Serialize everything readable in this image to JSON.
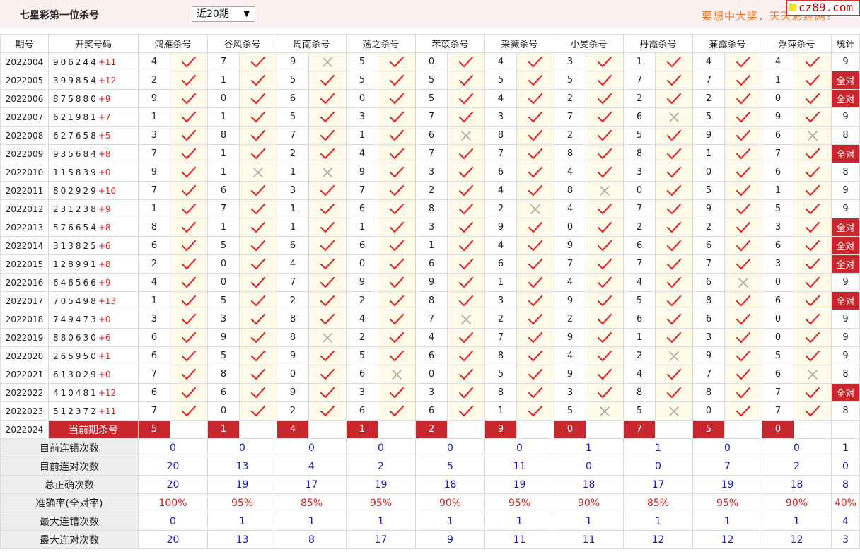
{
  "header": {
    "title": "七星彩第一位杀号",
    "period_select": "近20期",
    "slogan": "要想中大奖，天天彩经网！",
    "site": "cz89.com"
  },
  "columns": {
    "period": "期号",
    "numbers": "开奖号码",
    "experts": [
      "鸿雁杀号",
      "谷风杀号",
      "周南杀号",
      "荡之杀号",
      "芣苡杀号",
      "采薇杀号",
      "小旻杀号",
      "丹霞杀号",
      "蒹露杀号",
      "浮萍杀号"
    ],
    "stat": "统计"
  },
  "rows": [
    {
      "period": "2022004",
      "nums": "906244",
      "extra": "+11",
      "kills": [
        4,
        7,
        9,
        5,
        0,
        4,
        3,
        1,
        4,
        4
      ],
      "ok": [
        1,
        1,
        0,
        1,
        1,
        1,
        1,
        1,
        1,
        1
      ],
      "stat": "9"
    },
    {
      "period": "2022005",
      "nums": "399854",
      "extra": "+12",
      "kills": [
        2,
        1,
        5,
        5,
        5,
        5,
        5,
        7,
        7,
        1
      ],
      "ok": [
        1,
        1,
        1,
        1,
        1,
        1,
        1,
        1,
        1,
        1
      ],
      "stat": "全对"
    },
    {
      "period": "2022006",
      "nums": "875880",
      "extra": "+9",
      "kills": [
        9,
        0,
        6,
        0,
        5,
        4,
        2,
        2,
        2,
        0
      ],
      "ok": [
        1,
        1,
        1,
        1,
        1,
        1,
        1,
        1,
        1,
        1
      ],
      "stat": "全对"
    },
    {
      "period": "2022007",
      "nums": "621981",
      "extra": "+7",
      "kills": [
        1,
        1,
        5,
        3,
        7,
        3,
        7,
        6,
        5,
        9
      ],
      "ok": [
        1,
        1,
        1,
        1,
        1,
        1,
        1,
        0,
        1,
        1
      ],
      "stat": "9"
    },
    {
      "period": "2022008",
      "nums": "627658",
      "extra": "+5",
      "kills": [
        3,
        8,
        7,
        1,
        6,
        8,
        2,
        5,
        9,
        6
      ],
      "ok": [
        1,
        1,
        1,
        1,
        0,
        1,
        1,
        1,
        1,
        0
      ],
      "stat": "8"
    },
    {
      "period": "2022009",
      "nums": "935684",
      "extra": "+8",
      "kills": [
        7,
        1,
        2,
        4,
        7,
        7,
        8,
        8,
        1,
        7
      ],
      "ok": [
        1,
        1,
        1,
        1,
        1,
        1,
        1,
        1,
        1,
        1
      ],
      "stat": "全对"
    },
    {
      "period": "2022010",
      "nums": "115839",
      "extra": "+0",
      "kills": [
        9,
        1,
        1,
        9,
        3,
        6,
        4,
        3,
        0,
        6
      ],
      "ok": [
        1,
        0,
        0,
        1,
        1,
        1,
        1,
        1,
        1,
        1
      ],
      "stat": "8"
    },
    {
      "period": "2022011",
      "nums": "802929",
      "extra": "+10",
      "kills": [
        7,
        6,
        3,
        7,
        2,
        4,
        8,
        0,
        5,
        1
      ],
      "ok": [
        1,
        1,
        1,
        1,
        1,
        1,
        0,
        1,
        1,
        1
      ],
      "stat": "9"
    },
    {
      "period": "2022012",
      "nums": "231238",
      "extra": "+9",
      "kills": [
        1,
        7,
        1,
        6,
        8,
        2,
        4,
        7,
        9,
        5
      ],
      "ok": [
        1,
        1,
        1,
        1,
        1,
        0,
        1,
        1,
        1,
        1
      ],
      "stat": "9"
    },
    {
      "period": "2022013",
      "nums": "576654",
      "extra": "+8",
      "kills": [
        8,
        1,
        1,
        1,
        3,
        9,
        0,
        2,
        2,
        3
      ],
      "ok": [
        1,
        1,
        1,
        1,
        1,
        1,
        1,
        1,
        1,
        1
      ],
      "stat": "全对"
    },
    {
      "period": "2022014",
      "nums": "313825",
      "extra": "+6",
      "kills": [
        6,
        5,
        6,
        6,
        1,
        4,
        9,
        6,
        6,
        6
      ],
      "ok": [
        1,
        1,
        1,
        1,
        1,
        1,
        1,
        1,
        1,
        1
      ],
      "stat": "全对"
    },
    {
      "period": "2022015",
      "nums": "128991",
      "extra": "+8",
      "kills": [
        2,
        0,
        4,
        0,
        6,
        6,
        7,
        7,
        7,
        3
      ],
      "ok": [
        1,
        1,
        1,
        1,
        1,
        1,
        1,
        1,
        1,
        1
      ],
      "stat": "全对"
    },
    {
      "period": "2022016",
      "nums": "646566",
      "extra": "+9",
      "kills": [
        4,
        0,
        7,
        9,
        9,
        1,
        4,
        4,
        6,
        0
      ],
      "ok": [
        1,
        1,
        1,
        1,
        1,
        1,
        1,
        1,
        0,
        1
      ],
      "stat": "9"
    },
    {
      "period": "2022017",
      "nums": "705498",
      "extra": "+13",
      "kills": [
        1,
        5,
        2,
        2,
        8,
        3,
        9,
        5,
        8,
        6
      ],
      "ok": [
        1,
        1,
        1,
        1,
        1,
        1,
        1,
        1,
        1,
        1
      ],
      "stat": "全对"
    },
    {
      "period": "2022018",
      "nums": "749473",
      "extra": "+0",
      "kills": [
        3,
        3,
        8,
        4,
        7,
        2,
        2,
        6,
        6,
        0
      ],
      "ok": [
        1,
        1,
        1,
        1,
        0,
        1,
        1,
        1,
        1,
        1
      ],
      "stat": "9"
    },
    {
      "period": "2022019",
      "nums": "880630",
      "extra": "+6",
      "kills": [
        6,
        9,
        8,
        2,
        4,
        7,
        9,
        1,
        3,
        0
      ],
      "ok": [
        1,
        1,
        0,
        1,
        1,
        1,
        1,
        1,
        1,
        1
      ],
      "stat": "9"
    },
    {
      "period": "2022020",
      "nums": "265950",
      "extra": "+1",
      "kills": [
        6,
        5,
        9,
        5,
        6,
        8,
        4,
        2,
        9,
        5
      ],
      "ok": [
        1,
        1,
        1,
        1,
        1,
        1,
        1,
        0,
        1,
        1
      ],
      "stat": "9"
    },
    {
      "period": "2022021",
      "nums": "613029",
      "extra": "+0",
      "kills": [
        7,
        8,
        0,
        6,
        0,
        5,
        9,
        4,
        7,
        6
      ],
      "ok": [
        1,
        1,
        1,
        0,
        1,
        1,
        1,
        1,
        1,
        0
      ],
      "stat": "8"
    },
    {
      "period": "2022022",
      "nums": "410481",
      "extra": "+12",
      "kills": [
        6,
        6,
        9,
        3,
        3,
        8,
        3,
        8,
        8,
        7
      ],
      "ok": [
        1,
        1,
        1,
        1,
        1,
        1,
        1,
        1,
        1,
        1
      ],
      "stat": "全对"
    },
    {
      "period": "2022023",
      "nums": "512372",
      "extra": "+11",
      "kills": [
        7,
        0,
        2,
        6,
        6,
        1,
        5,
        5,
        0,
        7
      ],
      "ok": [
        1,
        1,
        1,
        1,
        1,
        1,
        0,
        0,
        1,
        1
      ],
      "stat": "8"
    }
  ],
  "current": {
    "period": "2022024",
    "label": "当前期杀号",
    "kills": [
      "5",
      "1",
      "4",
      "1",
      "2",
      "9",
      "0",
      "7",
      "5",
      "0"
    ]
  },
  "summary": [
    {
      "label": "目前连错次数",
      "values": [
        "0",
        "0",
        "0",
        "0",
        "0",
        "0",
        "1",
        "1",
        "0",
        "0"
      ],
      "stat": "1"
    },
    {
      "label": "目前连对次数",
      "values": [
        "20",
        "13",
        "4",
        "2",
        "5",
        "11",
        "0",
        "0",
        "7",
        "2"
      ],
      "stat": "0"
    },
    {
      "label": "总正确次数",
      "values": [
        "20",
        "19",
        "17",
        "19",
        "18",
        "19",
        "18",
        "17",
        "19",
        "18"
      ],
      "stat": "8"
    },
    {
      "label": "准确率(全对率)",
      "values": [
        "100%",
        "95%",
        "85%",
        "95%",
        "90%",
        "95%",
        "90%",
        "85%",
        "95%",
        "90%"
      ],
      "stat": "40%",
      "rate": true
    },
    {
      "label": "最大连错次数",
      "values": [
        "0",
        "1",
        "1",
        "1",
        "1",
        "1",
        "1",
        "1",
        "1",
        "1"
      ],
      "stat": "4"
    },
    {
      "label": "最大连对次数",
      "values": [
        "20",
        "13",
        "8",
        "17",
        "9",
        "11",
        "11",
        "12",
        "12",
        "12"
      ],
      "stat": "3"
    }
  ],
  "colors": {
    "accent_red": "#c8282d",
    "check_red": "#e0282d",
    "cross_gray": "#aaaaaa",
    "stat_blue": "#1a1aa8"
  },
  "icons": {
    "hit": "check-icon",
    "miss": "cross-icon"
  }
}
